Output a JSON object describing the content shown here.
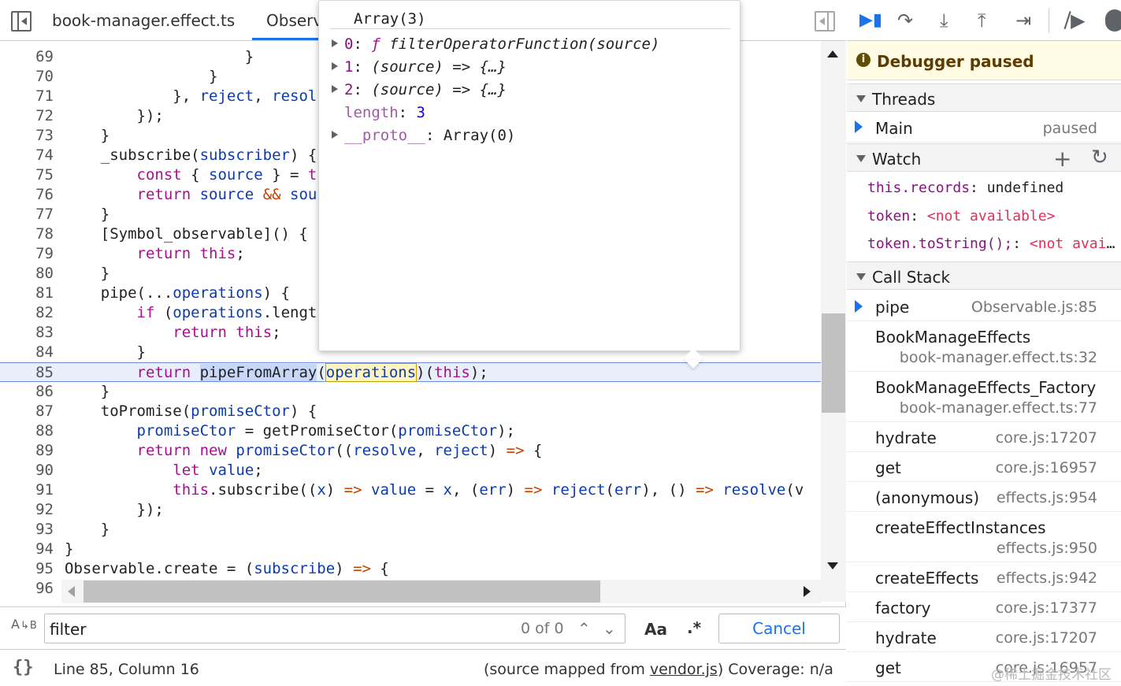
{
  "tabs": [
    {
      "label": "book-manager.effect.ts"
    },
    {
      "label": "Observ"
    }
  ],
  "code_lines": [
    {
      "n": "69",
      "html": "                    }"
    },
    {
      "n": "70",
      "html": "                }"
    },
    {
      "n": "71",
      "html": "            }, <span class='pm'>reject</span>, <span class='pm'>resol</span>"
    },
    {
      "n": "72",
      "html": "        });"
    },
    {
      "n": "73",
      "html": "    }"
    },
    {
      "n": "74",
      "html": "    _subscribe(<span class='pm'>subscriber</span>) {"
    },
    {
      "n": "75",
      "html": "        <span class='kw'>const</span> { <span class='pm'>source</span> } = <span class='kw'>t</span>"
    },
    {
      "n": "76",
      "html": "        <span class='kw'>return</span> <span class='pm'>source</span> <span class='op'>&amp;&amp;</span> <span class='pm'>sou</span>"
    },
    {
      "n": "77",
      "html": "    }"
    },
    {
      "n": "78",
      "html": "    [Symbol_observable]() {"
    },
    {
      "n": "79",
      "html": "        <span class='kw'>return</span> <span class='kw'>this</span>;"
    },
    {
      "n": "80",
      "html": "    }"
    },
    {
      "n": "81",
      "html": "    pipe(...<span class='pm'>operations</span>) {"
    },
    {
      "n": "82",
      "html": "        <span class='kw'>if</span> (<span class='pm'>operations</span>.lengt"
    },
    {
      "n": "83",
      "html": "            <span class='kw'>return</span> <span class='kw'>this</span>;"
    },
    {
      "n": "84",
      "html": "        }"
    },
    {
      "n": "85",
      "html": "        <span class='kw'>return</span> <span class='hl-sel'>pipeFromArray</span>(<span class='hl-hover pm'>operations</span>)(<span class='kw'>this</span>);",
      "current": true
    },
    {
      "n": "86",
      "html": "    }"
    },
    {
      "n": "87",
      "html": "    toPromise(<span class='pm'>promiseCtor</span>) {"
    },
    {
      "n": "88",
      "html": "        <span class='pm'>promiseCtor</span> = getPromiseCtor(<span class='pm'>promiseCtor</span>);"
    },
    {
      "n": "89",
      "html": "        <span class='kw'>return</span> <span class='kw'>new</span> <span class='pm'>promiseCtor</span>((<span class='pm'>resolve</span>, <span class='pm'>reject</span>) <span class='op'>=&gt;</span> {"
    },
    {
      "n": "90",
      "html": "            <span class='kw'>let</span> <span class='pm'>value</span>;"
    },
    {
      "n": "91",
      "html": "            <span class='kw'>this</span>.subscribe((<span class='pm'>x</span>) <span class='op'>=&gt;</span> <span class='pm'>value</span> = <span class='pm'>x</span>, (<span class='pm'>err</span>) <span class='op'>=&gt;</span> <span class='pm'>reject</span>(<span class='pm'>err</span>), () <span class='op'>=&gt;</span> <span class='pm'>resolve</span>(v"
    },
    {
      "n": "92",
      "html": "        });"
    },
    {
      "n": "93",
      "html": "    }"
    },
    {
      "n": "94",
      "html": "}"
    },
    {
      "n": "95",
      "html": "Observable.create = (<span class='pm'>subscribe</span>) <span class='op'>=&gt;</span> {"
    },
    {
      "n": "96",
      "html": ""
    }
  ],
  "popover": {
    "title": "Array(3)",
    "rows": [
      {
        "expandable": true,
        "key": "0",
        "sep": ": ",
        "value_html": "<span class='pital'><span class='kw'>ƒ</span> filterOperatorFunction(source)</span>"
      },
      {
        "expandable": true,
        "key": "1",
        "sep": ": ",
        "value_html": "<span class='pital'>(source) =&gt; {…}</span>"
      },
      {
        "expandable": true,
        "key": "2",
        "sep": ": ",
        "value_html": "<span class='pital'>(source) =&gt; {…}</span>"
      },
      {
        "expandable": false,
        "key": "length",
        "sep": ": ",
        "value_html": "<span class='pnum'>3</span>",
        "dim": true
      },
      {
        "expandable": true,
        "key": "__proto__",
        "sep": ": ",
        "value_html": "Array(0)",
        "dim": true
      }
    ]
  },
  "search": {
    "value": "filter",
    "count": "0 of 0",
    "prev": "⌃",
    "next": "⌄",
    "case_label": "Aa",
    "regex_label": ".*",
    "cancel": "Cancel",
    "replace_icon_label": "AB"
  },
  "status": {
    "format_icon": "{}",
    "cursor": "Line 85, Column 16",
    "mapped_prefix": "(source mapped from ",
    "mapped_file": "vendor.js",
    "mapped_suffix": ")  Coverage: n/a"
  },
  "debugger": {
    "paused_text": "Debugger paused",
    "threads_title": "Threads",
    "thread": {
      "name": "Main",
      "status": "paused"
    },
    "watch_title": "Watch",
    "watch": [
      {
        "expr": "this.records",
        "value": "undefined",
        "na": false
      },
      {
        "expr": "token",
        "value": "<not available>",
        "na": true
      },
      {
        "expr": "token.toString();",
        "value": "<not available>",
        "na": true
      }
    ],
    "callstack_title": "Call Stack",
    "frames": [
      {
        "name": "pipe",
        "loc": "Observable.js:85",
        "current": true,
        "wrap": false
      },
      {
        "name": "BookManageEffects",
        "loc": "book-manager.effect.ts:32",
        "current": false,
        "wrap": true
      },
      {
        "name": "BookManageEffects_Factory",
        "loc": "book-manager.effect.ts:77",
        "current": false,
        "wrap": true
      },
      {
        "name": "hydrate",
        "loc": "core.js:17207",
        "current": false,
        "wrap": false
      },
      {
        "name": "get",
        "loc": "core.js:16957",
        "current": false,
        "wrap": false
      },
      {
        "name": "(anonymous)",
        "loc": "effects.js:954",
        "current": false,
        "wrap": false
      },
      {
        "name": "createEffectInstances",
        "loc": "effects.js:950",
        "current": false,
        "wrap": true
      },
      {
        "name": "createEffects",
        "loc": "effects.js:942",
        "current": false,
        "wrap": false
      },
      {
        "name": "factory",
        "loc": "core.js:17377",
        "current": false,
        "wrap": false
      },
      {
        "name": "hydrate",
        "loc": "core.js:17207",
        "current": false,
        "wrap": false
      },
      {
        "name": "get",
        "loc": "core.js:16957",
        "current": false,
        "wrap": false
      }
    ]
  },
  "watermark": "@稀土掘金技术社区",
  "colors": {
    "accent": "#1a73e8",
    "paused_bg": "#fffbe5",
    "keyword": "#aa0d91"
  }
}
